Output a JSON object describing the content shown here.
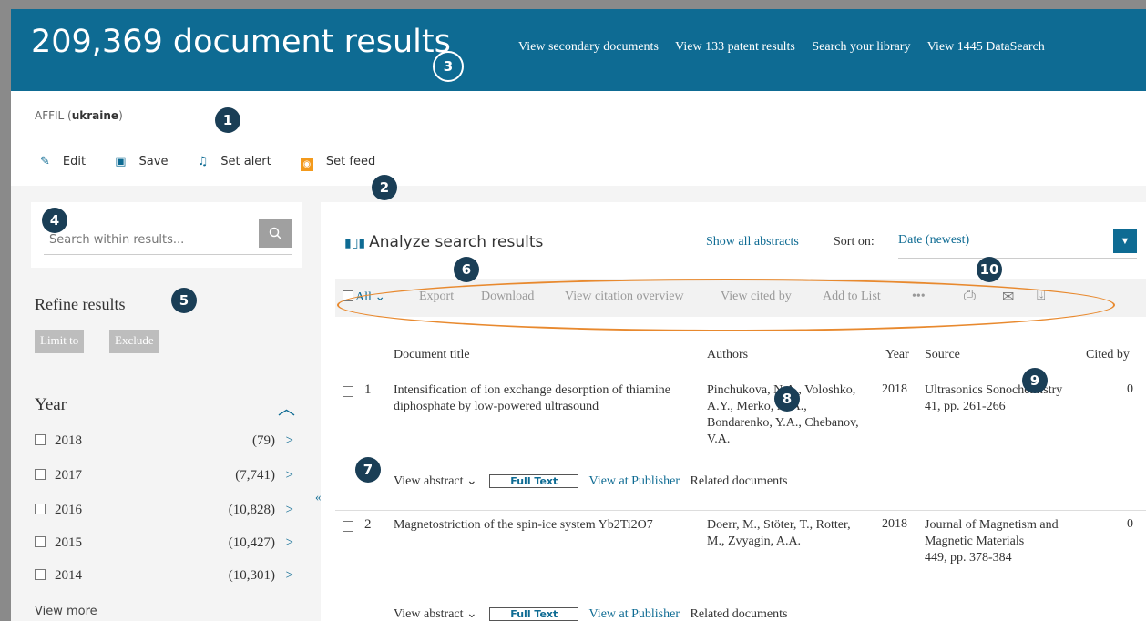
{
  "header": {
    "result_count": "209,369 document results",
    "links": [
      "View secondary documents",
      "View 133 patent results",
      "Search your library",
      "View 1445 DataSearch"
    ]
  },
  "query": {
    "prefix": "AFFIL (",
    "term": "ukraine",
    "suffix": ")",
    "actions": {
      "edit": "Edit",
      "save": "Save",
      "set_alert": "Set alert",
      "set_feed": "Set feed"
    }
  },
  "sidebar": {
    "search_placeholder": "Search within results...",
    "refine_title": "Refine results",
    "limit_to": "Limit to",
    "exclude": "Exclude",
    "year_title": "Year",
    "years": [
      {
        "year": "2018",
        "count": "(79)"
      },
      {
        "year": "2017",
        "count": "(7,741)"
      },
      {
        "year": "2016",
        "count": "(10,828)"
      },
      {
        "year": "2015",
        "count": "(10,427)"
      },
      {
        "year": "2014",
        "count": "(10,301)"
      }
    ],
    "view_more": "View more"
  },
  "main": {
    "analyze": "Analyze search results",
    "show_abstracts": "Show all abstracts",
    "sort_label": "Sort on:",
    "sort_value": "Date (newest)",
    "toolbar": {
      "all": "All",
      "export": "Export",
      "download": "Download",
      "citation_overview": "View citation overview",
      "cited_by": "View cited by",
      "add_to_list": "Add to List",
      "more": "•••"
    },
    "columns": {
      "title": "Document title",
      "authors": "Authors",
      "year": "Year",
      "source": "Source",
      "cited": "Cited by"
    },
    "results": [
      {
        "num": "1",
        "title": "Intensification of ion exchange desorption of thiamine diphosphate by low-powered ultrasound",
        "authors": "Pinchukova, N.A., Voloshko, A.Y., Merko, M.A., Bondarenko, Y.A., Chebanov, V.A.",
        "year": "2018",
        "source": "Ultrasonics Sonochemistry",
        "source_detail": "41, pp. 261-266",
        "cited": "0"
      },
      {
        "num": "2",
        "title": "Magnetostriction of the spin-ice system Yb2Ti2O7",
        "authors": "Doerr, M., Stöter, T., Rotter, M., Zvyagin, A.A.",
        "year": "2018",
        "source": "Journal of Magnetism and Magnetic Materials",
        "source_detail": "449, pp. 378-384",
        "cited": "0"
      }
    ],
    "result_actions": {
      "view_abstract": "View abstract",
      "full_text": "Full Text",
      "view_publisher": "View at Publisher",
      "related": "Related documents"
    }
  },
  "callouts": [
    "1",
    "2",
    "3",
    "4",
    "5",
    "6",
    "7",
    "8",
    "9",
    "10"
  ],
  "colors": {
    "brand": "#0e6b93",
    "callout": "#1a3e56",
    "highlight": "#e8892e",
    "rss": "#f39a1c"
  }
}
